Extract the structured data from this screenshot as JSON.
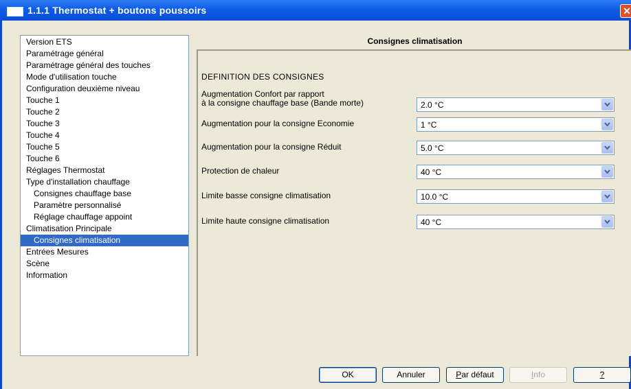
{
  "window": {
    "title": "1.1.1 Thermostat + boutons poussoirs",
    "close_label": "✕"
  },
  "tree": {
    "items": [
      {
        "label": "Version ETS",
        "level": 0,
        "selected": false
      },
      {
        "label": "Paramétrage général",
        "level": 0,
        "selected": false
      },
      {
        "label": "Paramétrage général des touches",
        "level": 0,
        "selected": false
      },
      {
        "label": "Mode d'utilisation touche",
        "level": 0,
        "selected": false
      },
      {
        "label": "Configuration deuxième niveau",
        "level": 0,
        "selected": false
      },
      {
        "label": "Touche 1",
        "level": 0,
        "selected": false
      },
      {
        "label": "Touche 2",
        "level": 0,
        "selected": false
      },
      {
        "label": "Touche 3",
        "level": 0,
        "selected": false
      },
      {
        "label": "Touche 4",
        "level": 0,
        "selected": false
      },
      {
        "label": "Touche 5",
        "level": 0,
        "selected": false
      },
      {
        "label": "Touche 6",
        "level": 0,
        "selected": false
      },
      {
        "label": "Réglages Thermostat",
        "level": 0,
        "selected": false
      },
      {
        "label": "Type d'installation chauffage",
        "level": 0,
        "selected": false
      },
      {
        "label": "Consignes chauffage base",
        "level": 1,
        "selected": false
      },
      {
        "label": "Paramètre personnalisé",
        "level": 1,
        "selected": false
      },
      {
        "label": "Réglage chauffage appoint",
        "level": 1,
        "selected": false
      },
      {
        "label": "Climatisation Principale",
        "level": 0,
        "selected": false
      },
      {
        "label": "Consignes climatisation",
        "level": 1,
        "selected": true
      },
      {
        "label": "Entrées Mesures",
        "level": 0,
        "selected": false
      },
      {
        "label": "Scène",
        "level": 0,
        "selected": false
      },
      {
        "label": "Information",
        "level": 0,
        "selected": false
      }
    ]
  },
  "panel": {
    "title": "Consignes climatisation",
    "section": "DEFINITION DES CONSIGNES",
    "rows": [
      {
        "label_lines": [
          "Augmentation Confort par rapport",
          "à la consigne chauffage base (Bande morte)"
        ],
        "value": "2.0 °C"
      },
      {
        "label_lines": [
          "Augmentation pour la consigne Economie"
        ],
        "value": "1 °C"
      },
      {
        "label_lines": [
          "Augmentation pour la consigne Réduit"
        ],
        "value": "5.0 °C"
      },
      {
        "label_lines": [
          "Protection de chaleur"
        ],
        "value": "40 °C"
      },
      {
        "label_lines": [
          "Limite basse consigne climatisation"
        ],
        "value": "10.0 °C"
      },
      {
        "label_lines": [
          "Limite haute consigne climatisation"
        ],
        "value": "40 °C"
      }
    ]
  },
  "buttons": {
    "ok": "OK",
    "cancel": "Annuler",
    "default_prefix": "P",
    "default_rest": "ar défaut",
    "info_prefix": "I",
    "info_rest": "nfo",
    "help": "?"
  }
}
